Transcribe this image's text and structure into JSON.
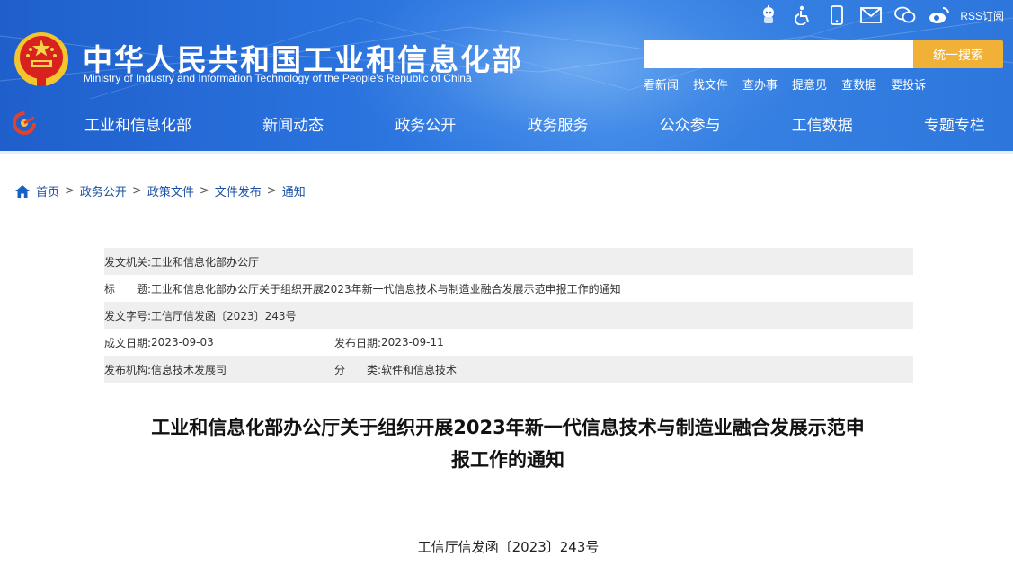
{
  "header": {
    "title": "中华人民共和国工业和信息化部",
    "subtitle": "Ministry of Industry and Information Technology of the People's Republic of China",
    "rss_label": "RSS订阅",
    "top_icons": [
      "robot-icon",
      "accessibility-icon",
      "mobile-icon",
      "mail-icon",
      "chat-icon",
      "weibo-icon"
    ]
  },
  "search": {
    "placeholder": "",
    "button_label": "统一搜索"
  },
  "quick_links": [
    "看新闻",
    "找文件",
    "查办事",
    "提意见",
    "查数据",
    "要投诉"
  ],
  "nav": {
    "items": [
      "工业和信息化部",
      "新闻动态",
      "政务公开",
      "政务服务",
      "公众参与",
      "工信数据",
      "专题专栏"
    ]
  },
  "breadcrumb": {
    "items": [
      "首页",
      "政务公开",
      "政策文件",
      "文件发布",
      "通知"
    ],
    "separator": ">"
  },
  "meta": {
    "issuer_label": "发文机关:",
    "issuer": "工业和信息化部办公厅",
    "title_label": "标　　题:",
    "title": "工业和信息化部办公厅关于组织开展2023年新一代信息技术与制造业融合发展示范申报工作的通知",
    "doc_no_label": "发文字号:",
    "doc_no": "工信厅信发函〔2023〕243号",
    "created_label": "成文日期:",
    "created": "2023-09-03",
    "published_label": "发布日期:",
    "published": "2023-09-11",
    "org_label": "发布机构:",
    "org": "信息技术发展司",
    "category_label": "分　　类:",
    "category": "软件和信息技术"
  },
  "article": {
    "title_line1": "工业和信息化部办公厅关于组织开展2023年新一代信息技术与制造业融合发展示范申",
    "title_line2": "报工作的通知",
    "doc_number": "工信厅信发函〔2023〕243号"
  },
  "colors": {
    "header_blue": "#2a73de",
    "search_button": "#f1b137",
    "link_blue": "#1a4fa3",
    "row_shade": "#efefef"
  }
}
